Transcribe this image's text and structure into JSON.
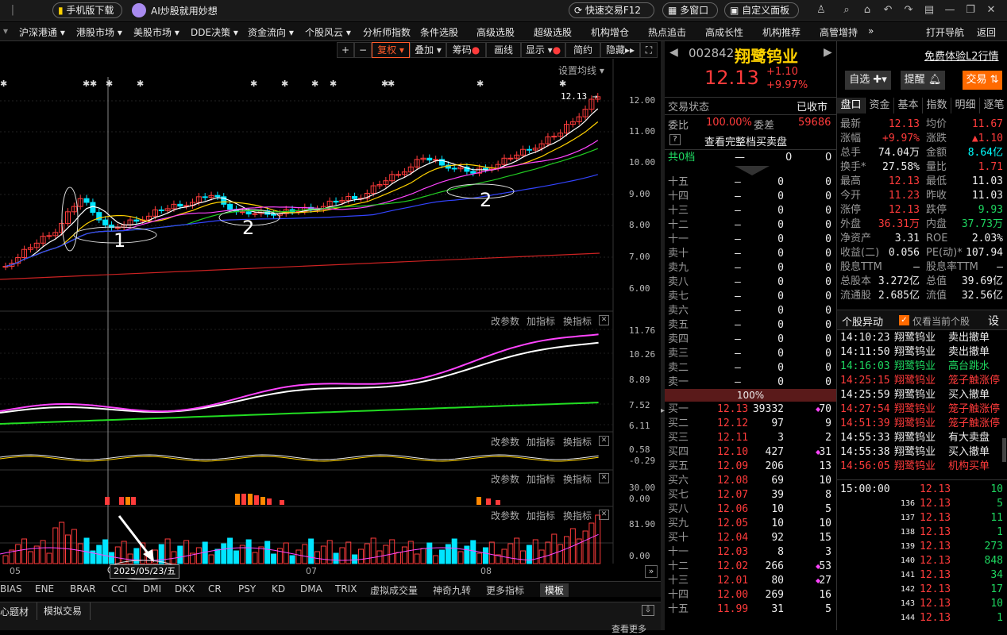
{
  "topbar": {
    "mobile_download": "手机版下载",
    "ai_slogan": "AI炒股就用妙想",
    "quick_trade": "快速交易F12",
    "multi_window": "多窗口",
    "custom_panel": "自定义面板"
  },
  "menu": [
    "沪深港通 ▾",
    "港股市场 ▾",
    "美股市场 ▾",
    "DDE决策 ▾",
    "资金流向 ▾",
    "个股风云 ▾",
    "分析师指数",
    "条件选股",
    "高级选股",
    "超级选股",
    "机构增仓",
    "热点追击",
    "高成长性",
    "机构推荐",
    "高管增持",
    "»",
    "打开导航",
    "返回"
  ],
  "chart_toolbar": {
    "plus": "+",
    "minus": "−",
    "fuquan": "复权",
    "overlay": "叠加",
    "chips": "筹码",
    "draw": "画线",
    "display": "显示",
    "simple": "简约",
    "hide": "隐藏▸▸",
    "set_ma": "设置均线"
  },
  "price_axis": [
    "12.00",
    "11.00",
    "10.00",
    "9.00",
    "8.00",
    "7.00",
    "6.00"
  ],
  "last_price_label": "12.13",
  "annotations": [
    "1",
    "2",
    "2"
  ],
  "sub_panel_buttons": {
    "params": "改参数",
    "add": "加指标",
    "switch": "换指标"
  },
  "macd_axis": [
    "11.76",
    "10.26",
    "8.89",
    "7.52",
    "6.11"
  ],
  "bias_axis": [
    "0.58",
    "-0.29"
  ],
  "vol2_axis": [
    "30.00",
    "0.00"
  ],
  "vol_axis": [
    "81.90",
    "0.00"
  ],
  "time_axis": {
    "m1": "05",
    "m2": "07",
    "m3": "08",
    "cursor_date": "2025/05/23/五"
  },
  "indicator_tabs": [
    "BIAS",
    "ENE",
    "BRAR",
    "CCI",
    "DMI",
    "DKX",
    "CR",
    "PSY",
    "KD",
    "DMA",
    "TRIX",
    "虚拟成交量",
    "神奇九转",
    "更多指标",
    "模板"
  ],
  "status_tabs": [
    "心题材",
    "模拟交易"
  ],
  "status_more": "查看更多",
  "stock": {
    "code": "002842",
    "name": "翔鹭钨业",
    "price": "12.13",
    "change": "+1.10",
    "pct": "+9.97%",
    "l2_link": "免费体验L2行情",
    "watch": "自选",
    "alert": "提醒",
    "trade": "交易"
  },
  "trade_state": {
    "label": "交易状态",
    "value": "已收市"
  },
  "weibi": {
    "label": "委比",
    "value": "100.00%",
    "diff_label": "委差",
    "diff": "59686"
  },
  "full_book": "查看完整档买卖盘",
  "total_levels": {
    "label": "共0档",
    "price": "—",
    "v1": "0",
    "v2": "0"
  },
  "sell_levels": [
    {
      "label": "十五",
      "price": "—",
      "vol": "0",
      "n": "0"
    },
    {
      "label": "十四",
      "price": "—",
      "vol": "0",
      "n": "0"
    },
    {
      "label": "十三",
      "price": "—",
      "vol": "0",
      "n": "0"
    },
    {
      "label": "十二",
      "price": "—",
      "vol": "0",
      "n": "0"
    },
    {
      "label": "十一",
      "price": "—",
      "vol": "0",
      "n": "0"
    },
    {
      "label": "卖十",
      "price": "—",
      "vol": "0",
      "n": "0"
    },
    {
      "label": "卖九",
      "price": "—",
      "vol": "0",
      "n": "0"
    },
    {
      "label": "卖八",
      "price": "—",
      "vol": "0",
      "n": "0"
    },
    {
      "label": "卖七",
      "price": "—",
      "vol": "0",
      "n": "0"
    },
    {
      "label": "卖六",
      "price": "—",
      "vol": "0",
      "n": "0"
    },
    {
      "label": "卖五",
      "price": "—",
      "vol": "0",
      "n": "0"
    },
    {
      "label": "卖四",
      "price": "—",
      "vol": "0",
      "n": "0"
    },
    {
      "label": "卖三",
      "price": "—",
      "vol": "0",
      "n": "0"
    },
    {
      "label": "卖二",
      "price": "—",
      "vol": "0",
      "n": "0"
    },
    {
      "label": "卖一",
      "price": "—",
      "vol": "0",
      "n": "0"
    }
  ],
  "ratio_bar": "100%",
  "buy_levels": [
    {
      "label": "买一",
      "price": "12.13",
      "vol": "39332",
      "n": "70"
    },
    {
      "label": "买二",
      "price": "12.12",
      "vol": "97",
      "n": "9"
    },
    {
      "label": "买三",
      "price": "12.11",
      "vol": "3",
      "n": "2"
    },
    {
      "label": "买四",
      "price": "12.10",
      "vol": "427",
      "n": "31"
    },
    {
      "label": "买五",
      "price": "12.09",
      "vol": "206",
      "n": "13"
    },
    {
      "label": "买六",
      "price": "12.08",
      "vol": "69",
      "n": "10"
    },
    {
      "label": "买七",
      "price": "12.07",
      "vol": "39",
      "n": "8"
    },
    {
      "label": "买八",
      "price": "12.06",
      "vol": "10",
      "n": "5"
    },
    {
      "label": "买九",
      "price": "12.05",
      "vol": "10",
      "n": "10"
    },
    {
      "label": "买十",
      "price": "12.04",
      "vol": "92",
      "n": "15"
    },
    {
      "label": "十一",
      "price": "12.03",
      "vol": "8",
      "n": "3"
    },
    {
      "label": "十二",
      "price": "12.02",
      "vol": "266",
      "n": "53"
    },
    {
      "label": "十三",
      "price": "12.01",
      "vol": "80",
      "n": "27"
    },
    {
      "label": "十四",
      "price": "12.00",
      "vol": "269",
      "n": "16"
    },
    {
      "label": "十五",
      "price": "11.99",
      "vol": "31",
      "n": "5"
    }
  ],
  "right_tabs": [
    "盘口",
    "资金",
    "基本",
    "指数",
    "明细",
    "逐笔"
  ],
  "stats": [
    [
      "最新",
      "12.13",
      "均价",
      "11.67"
    ],
    [
      "涨幅",
      "+9.97%",
      "涨跌",
      "▲1.10"
    ],
    [
      "总手",
      "74.04万",
      "金额",
      "8.64亿"
    ],
    [
      "换手*",
      "27.58%",
      "量比",
      "1.71"
    ],
    [
      "最高",
      "12.13",
      "最低",
      "11.03"
    ],
    [
      "今开",
      "11.23",
      "昨收",
      "11.03"
    ],
    [
      "涨停",
      "12.13",
      "跌停",
      "9.93"
    ],
    [
      "外盘",
      "36.31万",
      "内盘",
      "37.73万"
    ],
    [
      "净资产",
      "3.31",
      "ROE",
      "2.03%"
    ],
    [
      "收益(二)",
      "0.056",
      "PE(动)*",
      "107.94"
    ],
    [
      "股息TTM",
      "—",
      "股息率TTM",
      "—"
    ],
    [
      "总股本",
      "3.272亿",
      "总值",
      "39.69亿"
    ],
    [
      "流通股",
      "2.685亿",
      "流值",
      "32.56亿"
    ]
  ],
  "alerts_header": {
    "title": "个股异动",
    "checkbox": "仅看当前个股",
    "settings": "设"
  },
  "alerts": [
    {
      "time": "14:10:23",
      "name": "翔鹭钨业",
      "event": "卖出撤单",
      "color": "white"
    },
    {
      "time": "14:11:50",
      "name": "翔鹭钨业",
      "event": "卖出撤单",
      "color": "white"
    },
    {
      "time": "14:16:03",
      "name": "翔鹭钨业",
      "event": "高台跳水",
      "color": "green"
    },
    {
      "time": "14:25:15",
      "name": "翔鹭钨业",
      "event": "笼子触涨停",
      "color": "red"
    },
    {
      "time": "14:25:59",
      "name": "翔鹭钨业",
      "event": "买入撤单",
      "color": "white"
    },
    {
      "time": "14:27:54",
      "name": "翔鹭钨业",
      "event": "笼子触涨停",
      "color": "red"
    },
    {
      "time": "14:51:39",
      "name": "翔鹭钨业",
      "event": "笼子触涨停",
      "color": "red"
    },
    {
      "time": "14:55:33",
      "name": "翔鹭钨业",
      "event": "有大卖盘",
      "color": "white"
    },
    {
      "time": "14:55:38",
      "name": "翔鹭钨业",
      "event": "买入撤单",
      "color": "white"
    },
    {
      "time": "14:56:05",
      "name": "翔鹭钨业",
      "event": "机构买单",
      "color": "red"
    }
  ],
  "ticks": [
    {
      "t": "15:00:00",
      "p": "12.13",
      "v": "10"
    },
    {
      "t": "136",
      "p": "12.13",
      "v": "5"
    },
    {
      "t": "137",
      "p": "12.13",
      "v": "11"
    },
    {
      "t": "138",
      "p": "12.13",
      "v": "1"
    },
    {
      "t": "139",
      "p": "12.13",
      "v": "273"
    },
    {
      "t": "140",
      "p": "12.13",
      "v": "848"
    },
    {
      "t": "141",
      "p": "12.13",
      "v": "34"
    },
    {
      "t": "142",
      "p": "12.13",
      "v": "17"
    },
    {
      "t": "143",
      "p": "12.13",
      "v": "10"
    },
    {
      "t": "144",
      "p": "12.13",
      "v": "1"
    }
  ],
  "colors": {
    "up": "#ff3b3b",
    "down": "#00e5ff",
    "accent": "#ff6a00"
  }
}
